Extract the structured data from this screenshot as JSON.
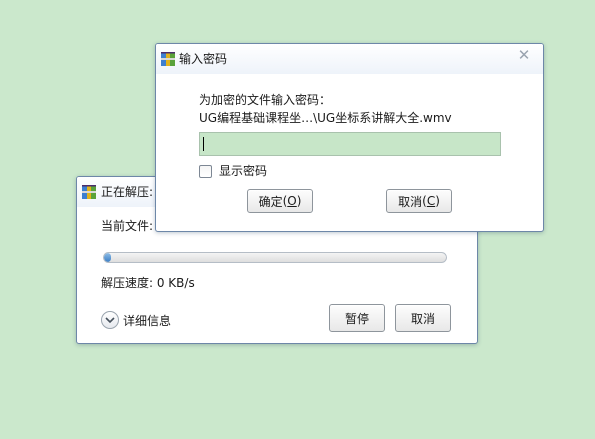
{
  "extract_dialog": {
    "title": "正在解压:",
    "current_file_label": "当前文件:",
    "speed_label": "解压速度: 0 KB/s",
    "progress": 0.01,
    "details_label": "详细信息",
    "pause_label": "暂停",
    "cancel_label": "取消"
  },
  "password_dialog": {
    "title": "输入密码",
    "prompt": "为加密的文件输入密码：",
    "file_path": "UG编程基础课程坐…\\UG坐标系讲解大全.wmv",
    "password_value": "",
    "show_password_label": "显示密码",
    "show_password_checked": false,
    "ok_label": "确定",
    "ok_mnemonic": "O",
    "cancel_label": "取消",
    "cancel_mnemonic": "C"
  },
  "icons": {
    "app": "winrar-app-icon",
    "close": "close-icon",
    "expand": "chevron-down-icon"
  },
  "colors": {
    "desktop": "#cbe8cc",
    "password_field": "#c7e6c8",
    "progress_fill": "#3b7fc6",
    "dialog_border": "#6d87a8"
  }
}
